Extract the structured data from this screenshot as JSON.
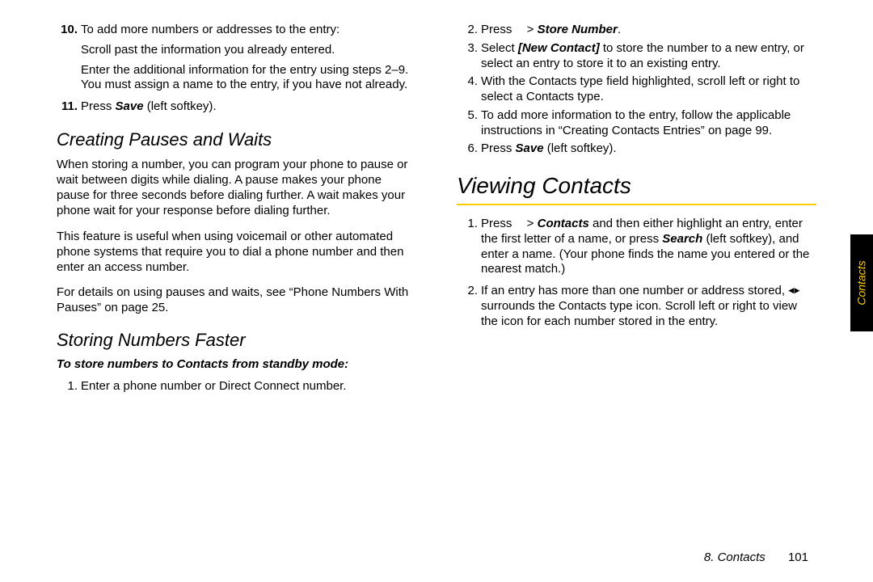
{
  "tab_label": "Contacts",
  "footer": {
    "chapter": "8. Contacts",
    "page": "101"
  },
  "left": {
    "step10_num": "10.",
    "step10_text": "To add more numbers or addresses to the entry:",
    "step10_sub1": "Scroll past the information you already entered.",
    "step10_sub2": "Enter the additional information for the entry using steps 2–9. You must assign a name to the entry, if you have not already.",
    "step11_num": "11.",
    "step11_pre": "Press ",
    "step11_bold": "Save",
    "step11_post": " (left softkey).",
    "h_pauses": "Creating Pauses and Waits",
    "pauses_p1": "When storing a number, you can program your phone to pause or wait between digits while dialing. A pause makes your phone pause for three seconds before dialing further. A wait makes your phone wait for your response before dialing further.",
    "pauses_p2": "This feature is useful when using voicemail or other automated phone systems that require you to dial a phone number and then enter an access number.",
    "pauses_p3": "For details on using pauses and waits, see “Phone Numbers With Pauses” on page 25.",
    "h_storing": "Storing Numbers Faster",
    "storing_task": "To store numbers to Contacts from standby mode:",
    "storing_s1_num": "1.",
    "storing_s1_text": "Enter a phone number or Direct Connect number."
  },
  "right": {
    "s2_num": "2.",
    "s2_pre": "Press ",
    "s2_mid": "  > ",
    "s2_bold": "Store Number",
    "s2_post": ".",
    "s3_num": "3.",
    "s3_pre": "Select ",
    "s3_bold": "[New Contact]",
    "s3_post": " to store the number to a new entry, or select an entry to store it to an existing entry.",
    "s4_num": "4.",
    "s4_text": "With the Contacts type field highlighted, scroll left or right to select a Contacts type.",
    "s5_num": "5.",
    "s5_text": "To add more information to the entry, follow the applicable instructions in “Creating Contacts Entries” on page 99.",
    "s6_num": "6.",
    "s6_pre": "Press ",
    "s6_bold": "Save",
    "s6_post": " (left softkey).",
    "h_viewing": "Viewing Contacts",
    "v1_num": "1.",
    "v1_pre": "Press ",
    "v1_mid": "  > ",
    "v1_bold1": "Contacts",
    "v1_mid2": " and then either highlight an entry, enter the first letter of a name, or press ",
    "v1_bold2": "Search",
    "v1_post": " (left softkey), and enter a name. (Your phone finds the name you entered or the nearest match.)",
    "v2_num": "2.",
    "v2_pre": "If an entry has more than one number or address stored, ",
    "v2_post": " surrounds the Contacts type icon. Scroll left or right to view the icon for each number stored in the entry."
  }
}
